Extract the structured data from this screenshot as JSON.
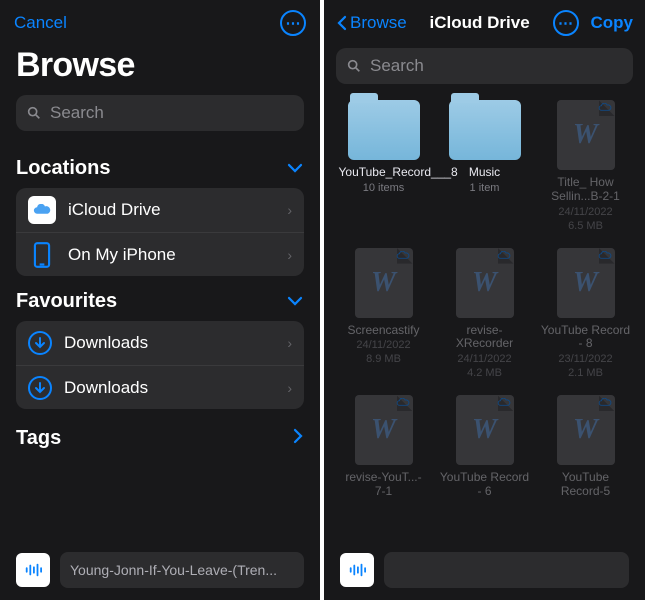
{
  "left": {
    "cancel": "Cancel",
    "more_icon": "⋯",
    "title": "Browse",
    "search_placeholder": "Search",
    "sections": {
      "locations": {
        "title": "Locations",
        "items": [
          {
            "label": "iCloud Drive"
          },
          {
            "label": "On My iPhone"
          }
        ]
      },
      "favourites": {
        "title": "Favourites",
        "items": [
          {
            "label": "Downloads"
          },
          {
            "label": "Downloads"
          }
        ]
      },
      "tags": {
        "title": "Tags"
      }
    },
    "now_playing": "Young-Jonn-If-You-Leave-(Tren..."
  },
  "right": {
    "back_label": "Browse",
    "title": "iCloud Drive",
    "copy": "Copy",
    "search_placeholder": "Search",
    "items": [
      {
        "name": "YouTube_Record___8",
        "sub": "10 items",
        "kind": "folder",
        "dim": false
      },
      {
        "name": "Music",
        "sub": "1 item",
        "kind": "folder",
        "dim": false
      },
      {
        "name": "Title_ How Sellin...B-2-1",
        "sub": "24/11/2022",
        "sub2": "6.5 MB",
        "kind": "doc",
        "dim": true
      },
      {
        "name": "Screencastify",
        "sub": "24/11/2022",
        "sub2": "8.9 MB",
        "kind": "doc",
        "dim": true
      },
      {
        "name": "revise-XRecorder",
        "sub": "24/11/2022",
        "sub2": "4.2 MB",
        "kind": "doc",
        "dim": true
      },
      {
        "name": "YouTube Record - 8",
        "sub": "23/11/2022",
        "sub2": "2.1 MB",
        "kind": "doc",
        "dim": true
      },
      {
        "name": "revise-YouT...- 7-1",
        "sub": "",
        "sub2": "",
        "kind": "doc",
        "dim": true
      },
      {
        "name": "YouTube Record - 6",
        "sub": "",
        "sub2": "",
        "kind": "doc",
        "dim": true
      },
      {
        "name": "YouTube Record-5",
        "sub": "",
        "sub2": "",
        "kind": "doc",
        "dim": true
      }
    ]
  }
}
